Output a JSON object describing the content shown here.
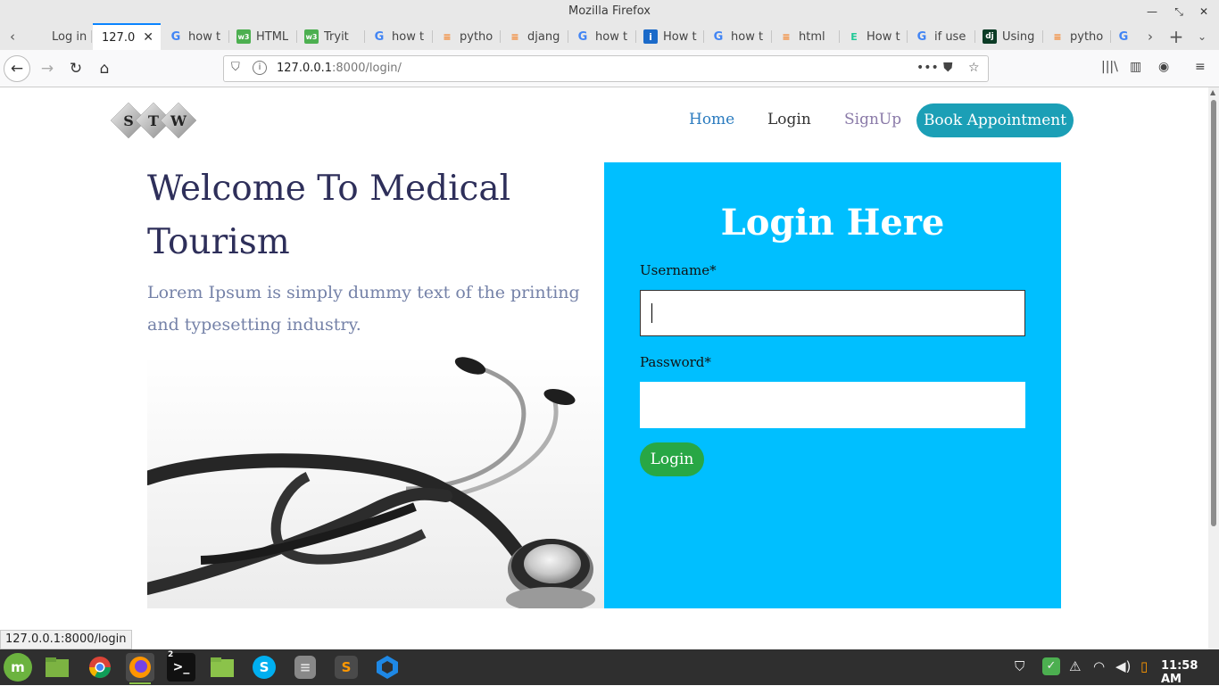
{
  "window": {
    "title": "Mozilla Firefox"
  },
  "tabs": [
    {
      "label": "Log in | D",
      "favicon": "django-icon"
    },
    {
      "label": "127.0.",
      "favicon": "page-icon",
      "active": true
    },
    {
      "label": "how t",
      "favicon": "google-icon"
    },
    {
      "label": "HTML",
      "favicon": "w3schools-icon"
    },
    {
      "label": "Tryit",
      "favicon": "w3schools-icon"
    },
    {
      "label": "how t",
      "favicon": "google-icon"
    },
    {
      "label": "pytho",
      "favicon": "stackoverflow-icon"
    },
    {
      "label": "djang",
      "favicon": "stackoverflow-icon"
    },
    {
      "label": "how t",
      "favicon": "google-icon"
    },
    {
      "label": "How t",
      "favicon": "mdn-icon"
    },
    {
      "label": "how t",
      "favicon": "google-icon"
    },
    {
      "label": "html",
      "favicon": "stackoverflow-icon"
    },
    {
      "label": "How t",
      "favicon": "educative-icon"
    },
    {
      "label": "if use",
      "favicon": "google-icon"
    },
    {
      "label": "Using",
      "favicon": "django-icon"
    },
    {
      "label": "pytho",
      "favicon": "stackoverflow-icon"
    }
  ],
  "urlbar": {
    "host": "127.0.0.1",
    "rest": ":8000/login/"
  },
  "site": {
    "logo_letters": [
      "S",
      "T",
      "W"
    ],
    "nav": {
      "home": "Home",
      "login": "Login",
      "signup": "SignUp",
      "book": "Book Appointment"
    },
    "hero": {
      "title": "Welcome To Medical Tourism",
      "text": "Lorem Ipsum is simply dummy text of the printing and typesetting industry."
    },
    "login": {
      "title": "Login Here",
      "username_label": "Username*",
      "username_value": "",
      "password_label": "Password*",
      "password_value": "",
      "button": "Login"
    }
  },
  "status_link": "127.0.0.1:8000/login",
  "taskbar": {
    "apps": [
      "linux-mint-menu",
      "files",
      "chrome",
      "firefox",
      "terminal",
      "file-manager",
      "skype",
      "database",
      "sublime-text",
      "qt-creator"
    ],
    "terminal_badge": "2",
    "clock": "11:58 AM"
  },
  "colors": {
    "login_panel": "#00bfff",
    "book_button": "#1b9fb6",
    "login_button": "#28a745",
    "title_text": "#2e2f5a"
  }
}
